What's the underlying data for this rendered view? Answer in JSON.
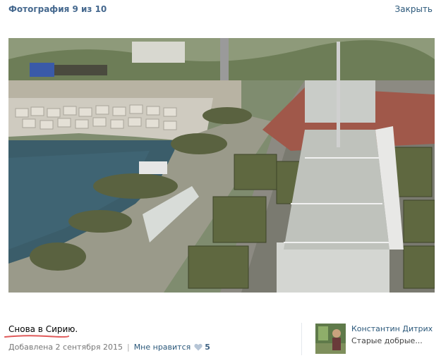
{
  "header": {
    "title": "Фотография 9 из 10",
    "close_label": "Закрыть"
  },
  "photo": {
    "description_icon": "photo-image"
  },
  "caption": {
    "text": "Снова в Сирию."
  },
  "meta": {
    "added": "Добавлена 2 сентября 2015",
    "separator": "|",
    "like_label": "Мне нравится",
    "like_count": "5"
  },
  "author": {
    "name": "Константин Дитрих",
    "status": "Старые добрые..."
  },
  "colors": {
    "link": "#2b587a",
    "title": "#45688e",
    "underline": "#e05a5a",
    "meta_text": "#777777"
  }
}
